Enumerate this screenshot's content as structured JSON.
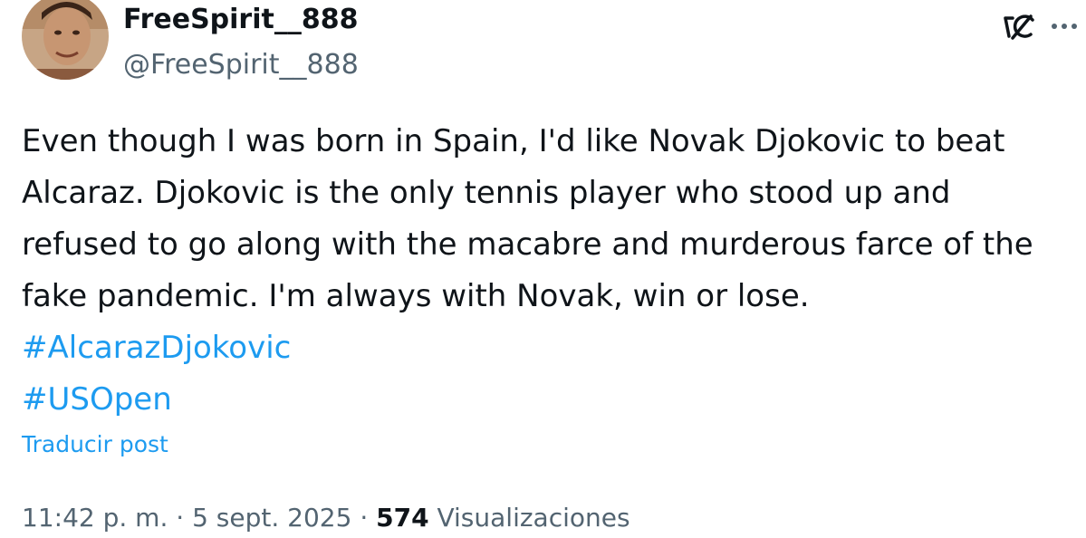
{
  "author": {
    "display_name": "FreeSpirit__888",
    "handle": "@FreeSpirit__888"
  },
  "tweet": {
    "text": "Even though I was born in Spain, I'd like Novak Djokovic to beat Alcaraz. Djokovic is the only tennis player who stood up and refused to go along with the macabre and murderous farce of the fake pandemic. I'm always with Novak, win or lose.",
    "hashtags": [
      "#AlcarazDjokovic",
      "#USOpen"
    ],
    "translate_label": "Traducir post"
  },
  "meta": {
    "time": "11:42 p. m.",
    "separator": "·",
    "date": "5 sept. 2025",
    "views_count": "574",
    "views_label": "Visualizaciones"
  },
  "icons": {
    "grok": "grok-icon",
    "more": "more-options-icon"
  },
  "colors": {
    "text": "#0f1419",
    "secondary": "#536471",
    "link": "#1d9bf0",
    "background": "#ffffff"
  }
}
